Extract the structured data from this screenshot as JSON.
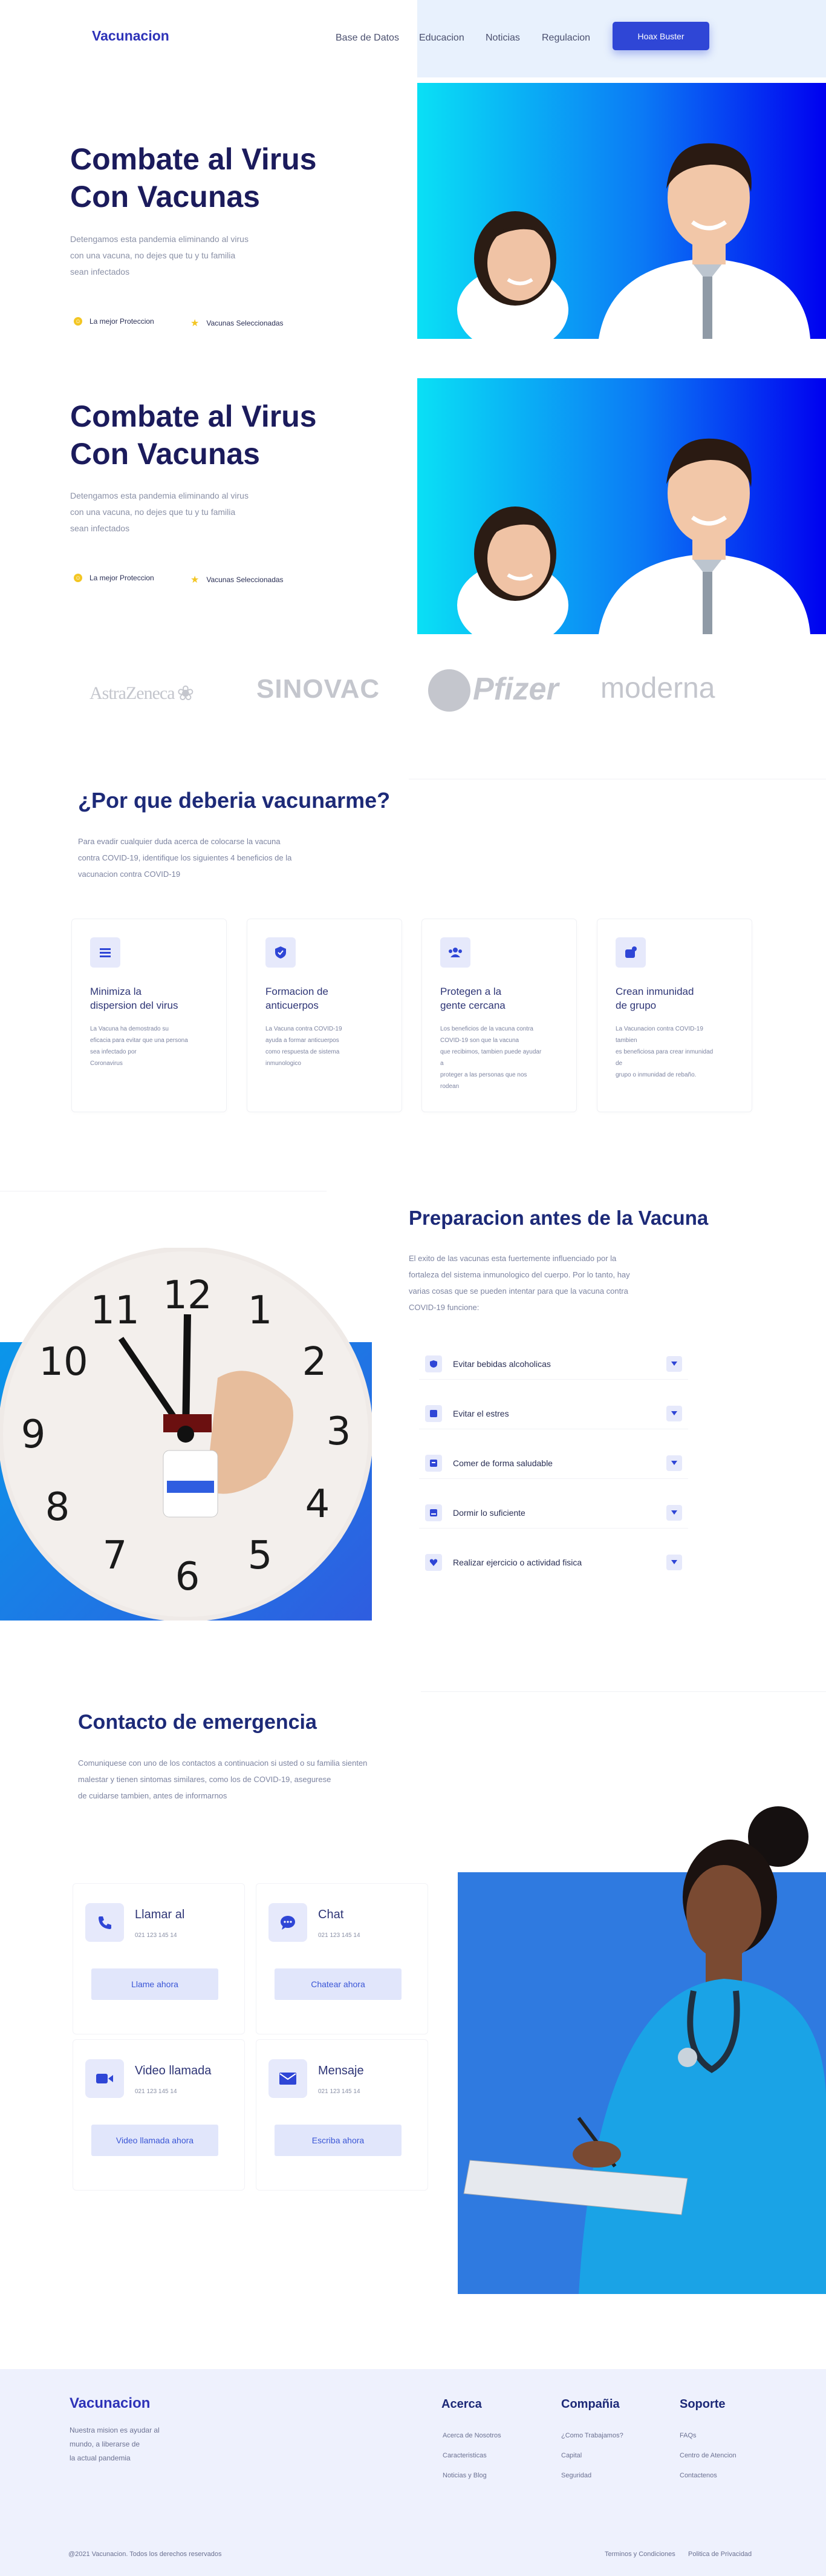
{
  "nav": {
    "logo": "Vacunacion",
    "links": [
      "Base de Datos",
      "Educacion",
      "Noticias",
      "Regulacion"
    ],
    "cta": "Hoax Buster"
  },
  "hero": [
    {
      "title_line1": "Combate al Virus",
      "title_line2": "Con Vacunas",
      "text_lines": [
        "Detengamos esta pandemia eliminando al virus",
        "con una vacuna, no dejes que tu y tu familia",
        "sean infectados"
      ],
      "features": [
        "La mejor Proteccion",
        "Vacunas Seleccionadas"
      ]
    },
    {
      "title_line1": "Combate al Virus",
      "title_line2": "Con Vacunas",
      "text_lines": [
        "Detengamos esta pandemia eliminando al virus",
        "con una vacuna, no dejes que tu y tu familia",
        "sean infectados"
      ],
      "features": [
        "La mejor Proteccion",
        "Vacunas Seleccionadas"
      ]
    }
  ],
  "brands": [
    "AstraZeneca",
    "SINOVAC",
    "Pfizer",
    "moderna"
  ],
  "why": {
    "title": "¿Por que deberia vacunarme?",
    "text_lines": [
      "Para evadir cualquier duda acerca de colocarse la vacuna",
      "contra COVID-19, identifique los siguientes 4 beneficios de la",
      "vacunacion contra COVID-19"
    ],
    "cards": [
      {
        "icon": "list-icon",
        "title_lines": [
          "Minimiza la",
          "dispersion del virus"
        ],
        "text_lines": [
          "La Vacuna ha demostrado su",
          "eficacia para evitar que una persona",
          "sea infectado por",
          "Coronavirus"
        ]
      },
      {
        "icon": "shield-check-icon",
        "title_lines": [
          "Formacion de",
          "anticuerpos"
        ],
        "text_lines": [
          "La Vacuna contra COVID-19",
          "ayuda a formar anticuerpos",
          "como respuesta de sistema inmunologico"
        ]
      },
      {
        "icon": "group-icon",
        "title_lines": [
          "Protegen a la",
          "gente cercana"
        ],
        "text_lines": [
          "Los beneficios de la vacuna contra",
          "COVID-19 son que la vacuna",
          "que recibimos, tambien puede ayudar a",
          "proteger a las personas que nos rodean"
        ]
      },
      {
        "icon": "immunity-icon",
        "title_lines": [
          "Crean inmunidad",
          "de grupo"
        ],
        "text_lines": [
          "La Vacunacion contra COVID-19 tambien",
          "es beneficiosa para crear inmunidad de",
          "grupo o inmunidad de rebaño."
        ]
      }
    ]
  },
  "prep": {
    "title": "Preparacion antes de la Vacuna",
    "text_lines": [
      "El exito de las vacunas esta fuertemente influenciado por la",
      "fortaleza del sistema inmunologico del cuerpo. Por lo tanto, hay",
      "varias cosas que se pueden intentar para que la vacuna contra",
      "COVID-19 funcione:"
    ],
    "items": [
      "Evitar bebidas alcoholicas",
      "Evitar el estres",
      "Comer de forma saludable",
      "Dormir lo suficiente",
      "Realizar ejercicio o actividad fisica"
    ],
    "clock_numbers": [
      "12",
      "1",
      "2",
      "3",
      "4",
      "5",
      "6",
      "7",
      "8",
      "9",
      "10",
      "11"
    ]
  },
  "contact": {
    "title": "Contacto de emergencia",
    "text_lines": [
      "Comuniquese con uno de los contactos a continuacion si usted o su familia sienten",
      "malestar y tienen sintomas similares, como los de COVID-19, asegurese",
      "de cuidarse tambien, antes de informarnos"
    ],
    "cards": [
      {
        "icon": "phone-icon",
        "title": "Llamar al",
        "phone": "021 123 145 14",
        "button": "Llame ahora"
      },
      {
        "icon": "chat-icon",
        "title": "Chat",
        "phone": "021 123 145 14",
        "button": "Chatear ahora"
      },
      {
        "icon": "video-icon",
        "title": "Video llamada",
        "phone": "021 123 145 14",
        "button": "Video llamada ahora"
      },
      {
        "icon": "mail-icon",
        "title": "Mensaje",
        "phone": "021 123 145 14",
        "button": "Escriba ahora"
      }
    ]
  },
  "footer": {
    "logo": "Vacunacion",
    "about_lines": [
      "Nuestra mision es ayudar al",
      "mundo, a liberarse de",
      "la actual pandemia"
    ],
    "columns": [
      {
        "title": "Acerca",
        "links": [
          "Acerca de Nosotros",
          "Caracteristicas",
          "Noticias y Blog"
        ]
      },
      {
        "title": "Compañia",
        "links": [
          "¿Como Trabajamos?",
          "Capital",
          "Seguridad"
        ]
      },
      {
        "title": "Soporte",
        "links": [
          "FAQs",
          "Centro de Atencion",
          "Contactenos"
        ]
      }
    ],
    "copyright": "@2021 Vacunacion. Todos los derechos reservados",
    "legal": [
      "Terminos y Condiciones",
      "Politica de Privacidad"
    ]
  },
  "colors": {
    "brand": "#2e33b8",
    "primary_button": "#2f46d6",
    "heading": "#1d2a78",
    "light_accent": "#e6e9fb",
    "footer_bg": "#eef1fd"
  }
}
